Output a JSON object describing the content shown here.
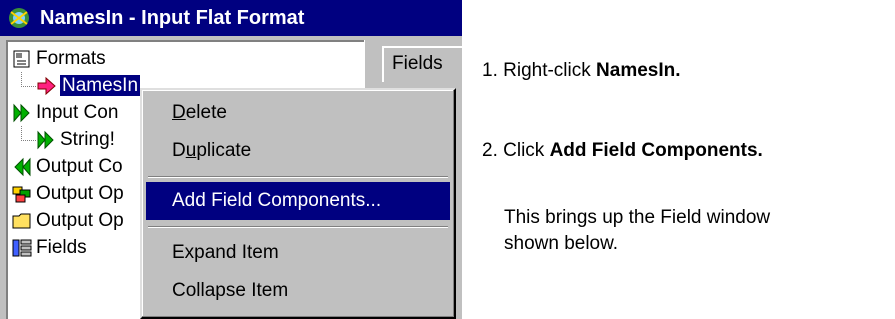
{
  "window": {
    "title": "NamesIn - Input Flat Format"
  },
  "tree": {
    "items": [
      {
        "label": "Formats",
        "icon": "formats-icon"
      },
      {
        "label": "NamesIn",
        "icon": "red-arrow-icon"
      },
      {
        "label": "Input Con",
        "icon": "green-arrow-icon"
      },
      {
        "label": "String!",
        "icon": "green-arrow-icon"
      },
      {
        "label": "Output Co",
        "icon": "green-double-arrow-icon"
      },
      {
        "label": "Output Op",
        "icon": "multicolor-icon"
      },
      {
        "label": "Output Op",
        "icon": "folder-icon"
      },
      {
        "label": "Fields",
        "icon": "fields-icon"
      }
    ]
  },
  "tab": {
    "fields_label": "Fields"
  },
  "context_menu": {
    "items": [
      {
        "label": "Delete",
        "mnemonic": "D"
      },
      {
        "label": "Duplicate",
        "mnemonic": "u"
      },
      {
        "label": "Add Field Components...",
        "selected": true
      },
      {
        "label": "Expand Item"
      },
      {
        "label": "Collapse Item"
      }
    ]
  },
  "instructions": {
    "step1_prefix": "1. Right-click ",
    "step1_bold": "NamesIn.",
    "step2_prefix": "2. Click ",
    "step2_bold": "Add Field Components.",
    "note_line1": "This brings up the Field window",
    "note_line2": "shown below."
  },
  "colors": {
    "titlebar": "#000080",
    "selection": "#000080",
    "chrome": "#c0c0c0"
  }
}
